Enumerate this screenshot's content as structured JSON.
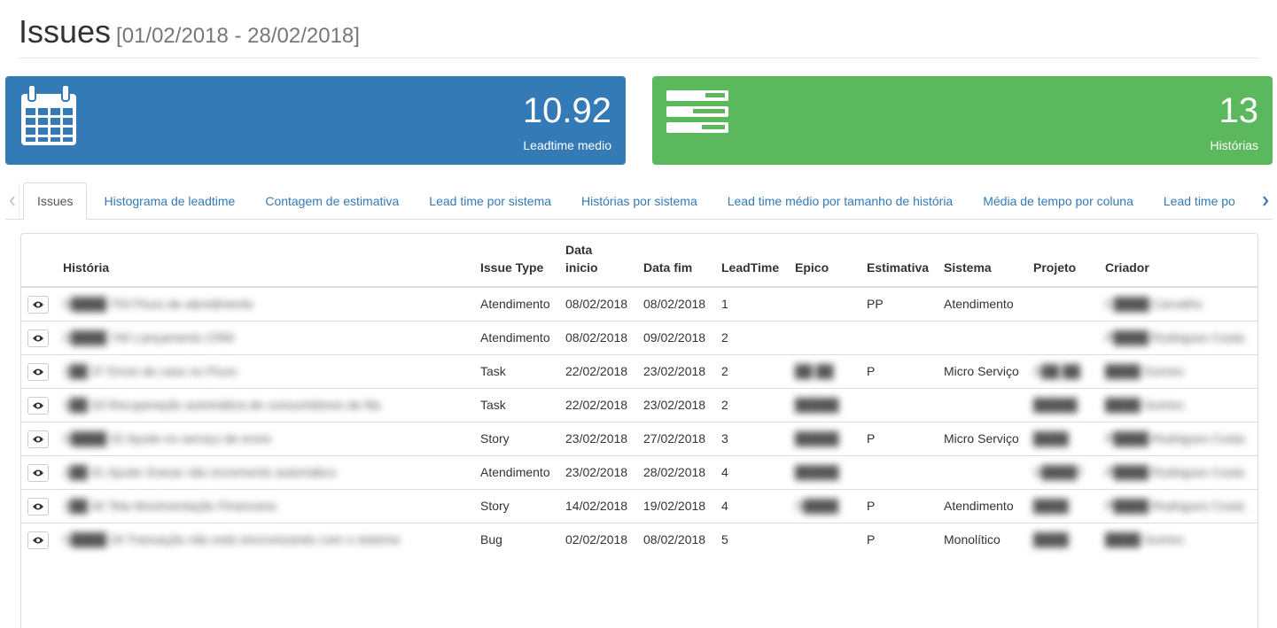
{
  "header": {
    "title": "Issues",
    "date_range": "[01/02/2018 - 28/02/2018]"
  },
  "cards": {
    "leadtime": {
      "value": "10.92",
      "label": "Leadtime medio",
      "color": "#337ab7",
      "icon": "calendar-icon"
    },
    "historias": {
      "value": "13",
      "label": "Histórias",
      "color": "#5cb85c",
      "icon": "tasks-list-icon"
    }
  },
  "tabs": [
    {
      "label": "Issues",
      "active": true
    },
    {
      "label": "Histograma de leadtime"
    },
    {
      "label": "Contagem de estimativa"
    },
    {
      "label": "Lead time por sistema"
    },
    {
      "label": "Histórias por sistema"
    },
    {
      "label": "Lead time médio por tamanho de história"
    },
    {
      "label": "Média de tempo por coluna"
    },
    {
      "label": "Lead time po"
    }
  ],
  "table": {
    "columns": {
      "historia": "História",
      "issue_type": "Issue Type",
      "data_inicio_1": "Data",
      "data_inicio_2": "inicio",
      "data_fim": "Data fim",
      "leadtime": "LeadTime",
      "epico": "Epico",
      "estimativa": "Estimativa",
      "sistema": "Sistema",
      "projeto": "Projeto",
      "criador": "Criador"
    },
    "rows": [
      {
        "historia": "S████ 753 Fluxo de atendimento",
        "issue_type": "Atendimento",
        "data_inicio": "08/02/2018",
        "data_fim": "08/02/2018",
        "leadtime": "1",
        "epico": "",
        "estimativa": "PP",
        "sistema": "Atendimento",
        "projeto": "",
        "criador": "C████ Carvalho"
      },
      {
        "historia": "S████ 740 Lançamento CRM",
        "issue_type": "Atendimento",
        "data_inicio": "08/02/2018",
        "data_fim": "09/02/2018",
        "leadtime": "2",
        "epico": "",
        "estimativa": "",
        "sistema": "",
        "projeto": "",
        "criador": "P████ Rodrigues Costa"
      },
      {
        "historia": "1██ 37 Envio de caso no Fluxo",
        "issue_type": "Task",
        "data_inicio": "22/02/2018",
        "data_fim": "23/02/2018",
        "leadtime": "2",
        "epico": "██ ██",
        "estimativa": "P",
        "sistema": "Micro Serviço",
        "projeto": "S██ ██",
        "criador": "████ Gomes"
      },
      {
        "historia": "1██ 33 Recuperação automática de consumidores de fila",
        "issue_type": "Task",
        "data_inicio": "22/02/2018",
        "data_fim": "23/02/2018",
        "leadtime": "2",
        "epico": "█████",
        "estimativa": "",
        "sistema": "",
        "projeto": "█████",
        "criador": "████ Gomes"
      },
      {
        "historia": "S████ 32 Ajuste no serviço de envio",
        "issue_type": "Story",
        "data_inicio": "23/02/2018",
        "data_fim": "27/02/2018",
        "leadtime": "3",
        "epico": "█████",
        "estimativa": "P",
        "sistema": "Micro Serviço",
        "projeto": "████",
        "criador": "P████ Rodrigues Costa"
      },
      {
        "historia": "1██ 31 Ajuste Gravar não incremento automático",
        "issue_type": "Atendimento",
        "data_inicio": "23/02/2018",
        "data_fim": "28/02/2018",
        "leadtime": "4",
        "epico": "█████",
        "estimativa": "",
        "sistema": "",
        "projeto": "S████7",
        "criador": "P████ Rodrigues Costa"
      },
      {
        "historia": "1██ 30 Tela Movimentação Financeira",
        "issue_type": "Story",
        "data_inicio": "14/02/2018",
        "data_fim": "19/02/2018",
        "leadtime": "4",
        "epico": "S████",
        "estimativa": "P",
        "sistema": "Atendimento",
        "projeto": "████",
        "criador": "P████ Rodrigues Costa"
      },
      {
        "historia": "S████ 29 Transação não está sincronizando com o sistema",
        "issue_type": "Bug",
        "data_inicio": "02/02/2018",
        "data_fim": "08/02/2018",
        "leadtime": "5",
        "epico": "",
        "estimativa": "P",
        "sistema": "Monolítico",
        "projeto": "████",
        "criador": "████ Gomes"
      }
    ]
  }
}
